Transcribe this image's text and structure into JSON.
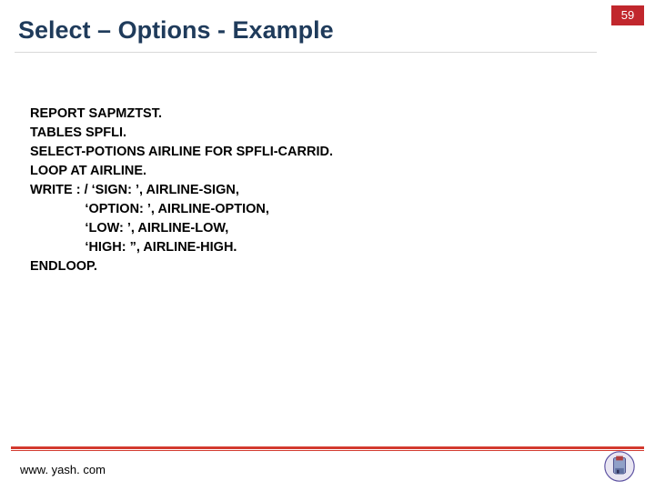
{
  "page_number": "59",
  "title": "Select – Options - Example",
  "code_lines": [
    "REPORT SAPMZTST.",
    "TABLES SPFLI.",
    "SELECT-POTIONS AIRLINE FOR SPFLI-CARRID.",
    "LOOP AT AIRLINE.",
    "WRITE : / ‘SIGN: ’, AIRLINE-SIGN,",
    "               ‘OPTION: ’, AIRLINE-OPTION,",
    "               ‘LOW: ’, AIRLINE-LOW,",
    "               ‘HIGH: ”, AIRLINE-HIGH.",
    "ENDLOOP."
  ],
  "footer_url": "www. yash. com"
}
